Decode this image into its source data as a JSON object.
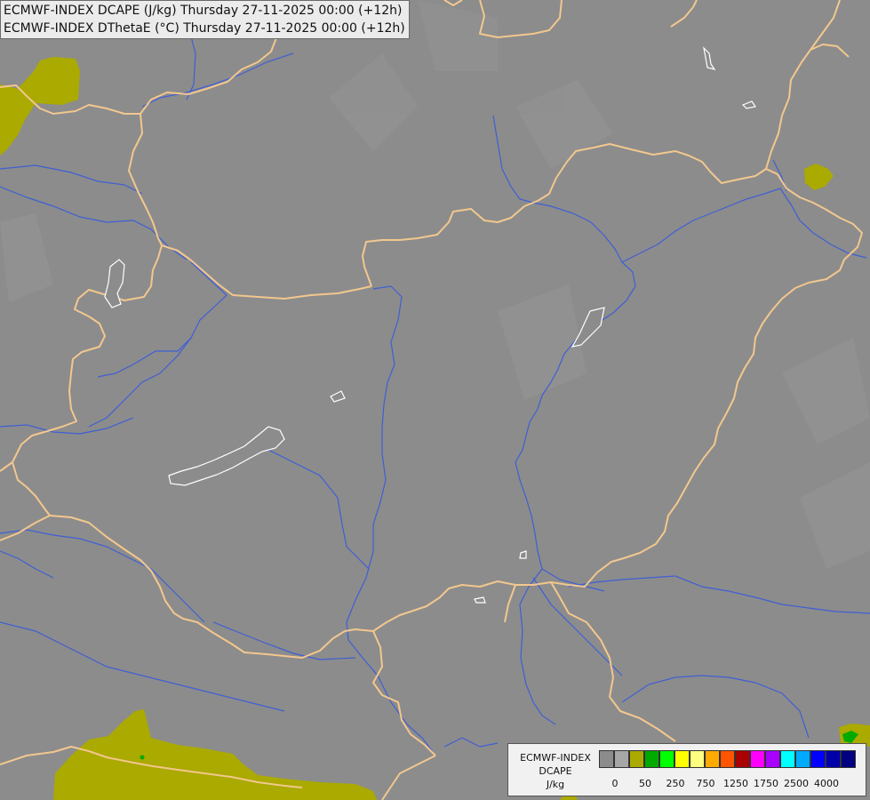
{
  "title": {
    "line1": "ECMWF-INDEX DCAPE (J/kg) Thursday 27-11-2025 00:00 (+12h)",
    "line2": "ECMWF-INDEX DThetaE (°C) Thursday 27-11-2025 00:00 (+12h)"
  },
  "colors": {
    "background": "#8c8c8c",
    "border": "#f2c78e",
    "river": "#3f5fd4",
    "lake": "#ffffff",
    "dcape_50": "#aaaa00",
    "dcape_250": "#00aa00"
  },
  "legend": {
    "label": [
      "ECMWF-INDEX",
      "DCAPE",
      "J/kg"
    ],
    "swatches": [
      "#8c8c8c",
      "#a6a6a6",
      "#aaaa00",
      "#00aa00",
      "#00ff00",
      "#ffff00",
      "#ffff80",
      "#ffaa00",
      "#ff5500",
      "#aa0000",
      "#ff00ff",
      "#aa00ff",
      "#00ffff",
      "#00aaff",
      "#0000ff",
      "#0000aa",
      "#000080"
    ],
    "ticks": [
      "0",
      "50",
      "250",
      "750",
      "1250",
      "1750",
      "2500",
      "4000"
    ]
  }
}
